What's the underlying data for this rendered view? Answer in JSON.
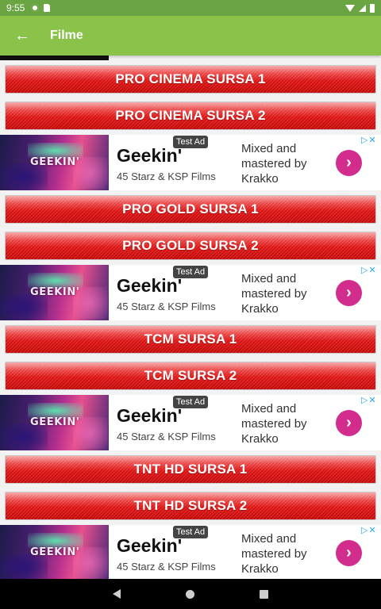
{
  "status_bar": {
    "time": "9:55",
    "left_icons": [
      "gear-icon",
      "sd-card-icon"
    ],
    "right_icons": [
      "wifi-icon",
      "signal-icon",
      "battery-icon"
    ],
    "bg_color": "#6aa443"
  },
  "app_bar": {
    "title": "Filme",
    "back_icon": "arrow-left-icon",
    "back_glyph": "←",
    "bg_color": "#8bc34a"
  },
  "buttons": [
    {
      "label": "PRO CINEMA SURSA 1"
    },
    {
      "label": "PRO CINEMA SURSA 2"
    },
    {
      "label": "PRO GOLD SURSA 1"
    },
    {
      "label": "PRO GOLD SURSA 2"
    },
    {
      "label": "TCM SURSA 1"
    },
    {
      "label": "TCM SURSA 2"
    },
    {
      "label": "TNT HD SURSA 1"
    },
    {
      "label": "TNT HD SURSA 2"
    }
  ],
  "ad": {
    "badge": "Test Ad",
    "title": "Geekin'",
    "subtitle": "45 Starz & KSP Films",
    "description": "Mixed and mastered by Krakko",
    "image_text": "GEEKIN'",
    "cta_glyph": "›",
    "choices_glyph": "▷✕",
    "accent_color": "#d22d8d"
  },
  "nav_bar": {
    "icons": [
      "back-triangle-icon",
      "home-circle-icon",
      "recents-square-icon"
    ]
  }
}
